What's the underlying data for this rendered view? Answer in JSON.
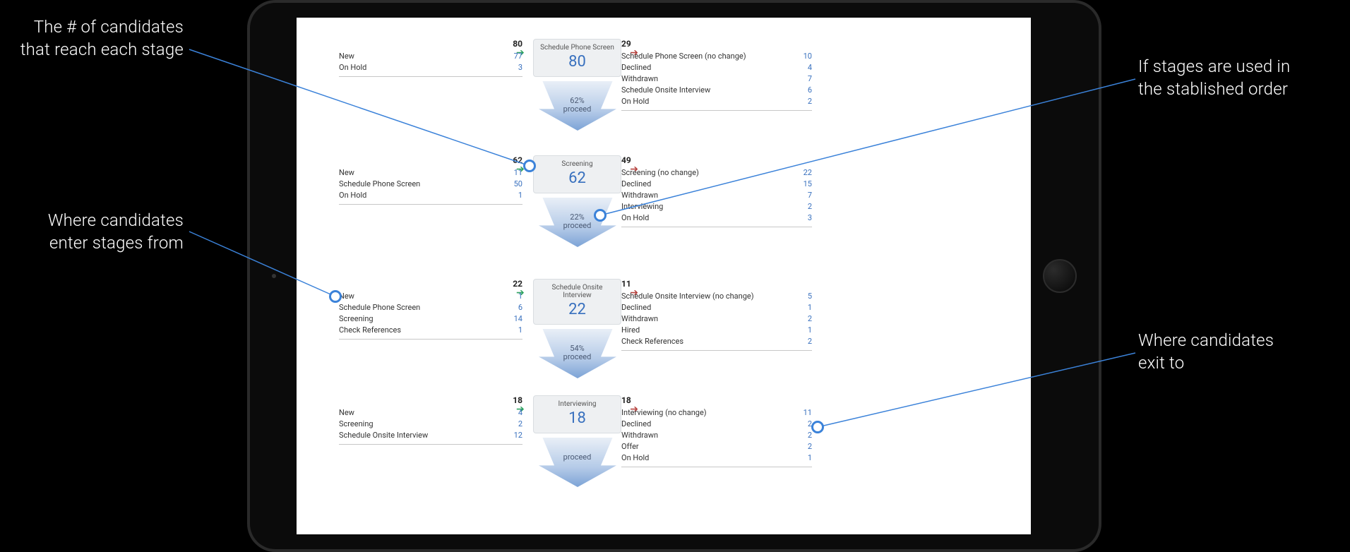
{
  "annotations": {
    "a1_line1": "The # of candidates",
    "a1_line2": "that reach each stage",
    "a2_line1": "If stages are used in",
    "a2_line2": "the stablished order",
    "a3_line1": "Where candidates",
    "a3_line2": "enter stages from",
    "a4_line1": "Where candidates",
    "a4_line2": "exit to"
  },
  "stages": [
    {
      "title": "Schedule Phone Screen",
      "count": "80",
      "proceed": "62%",
      "proceed_word": "proceed",
      "in_total": "80",
      "in_rows": [
        {
          "lbl": "New",
          "val": "77"
        },
        {
          "lbl": "On Hold",
          "val": "3"
        }
      ],
      "out_total": "29",
      "out_rows": [
        {
          "lbl": "Schedule Phone Screen (no change)",
          "val": "10"
        },
        {
          "lbl": "Declined",
          "val": "4"
        },
        {
          "lbl": "Withdrawn",
          "val": "7"
        },
        {
          "lbl": "Schedule Onsite Interview",
          "val": "6"
        },
        {
          "lbl": "On Hold",
          "val": "2"
        }
      ]
    },
    {
      "title": "Screening",
      "count": "62",
      "proceed": "22%",
      "proceed_word": "proceed",
      "in_total": "62",
      "in_rows": [
        {
          "lbl": "New",
          "val": "11"
        },
        {
          "lbl": "Schedule Phone Screen",
          "val": "50"
        },
        {
          "lbl": "On Hold",
          "val": "1"
        }
      ],
      "out_total": "49",
      "out_rows": [
        {
          "lbl": "Screening (no change)",
          "val": "22"
        },
        {
          "lbl": "Declined",
          "val": "15"
        },
        {
          "lbl": "Withdrawn",
          "val": "7"
        },
        {
          "lbl": "Interviewing",
          "val": "2"
        },
        {
          "lbl": "On Hold",
          "val": "3"
        }
      ]
    },
    {
      "title": "Schedule Onsite Interview",
      "count": "22",
      "proceed": "54%",
      "proceed_word": "proceed",
      "in_total": "22",
      "in_rows": [
        {
          "lbl": "New",
          "val": "1"
        },
        {
          "lbl": "Schedule Phone Screen",
          "val": "6"
        },
        {
          "lbl": "Screening",
          "val": "14"
        },
        {
          "lbl": "Check References",
          "val": "1"
        }
      ],
      "out_total": "11",
      "out_rows": [
        {
          "lbl": "Schedule Onsite Interview (no change)",
          "val": "5"
        },
        {
          "lbl": "Declined",
          "val": "1"
        },
        {
          "lbl": "Withdrawn",
          "val": "2"
        },
        {
          "lbl": "Hired",
          "val": "1"
        },
        {
          "lbl": "Check References",
          "val": "2"
        }
      ]
    },
    {
      "title": "Interviewing",
      "count": "18",
      "proceed": "",
      "proceed_word": "proceed",
      "in_total": "18",
      "in_rows": [
        {
          "lbl": "New",
          "val": "4"
        },
        {
          "lbl": "Screening",
          "val": "2"
        },
        {
          "lbl": "Schedule Onsite Interview",
          "val": "12"
        }
      ],
      "out_total": "18",
      "out_rows": [
        {
          "lbl": "Interviewing (no change)",
          "val": "11"
        },
        {
          "lbl": "Declined",
          "val": "2"
        },
        {
          "lbl": "Withdrawn",
          "val": "2"
        },
        {
          "lbl": "Offer",
          "val": "2"
        },
        {
          "lbl": "On Hold",
          "val": "1"
        }
      ]
    }
  ]
}
